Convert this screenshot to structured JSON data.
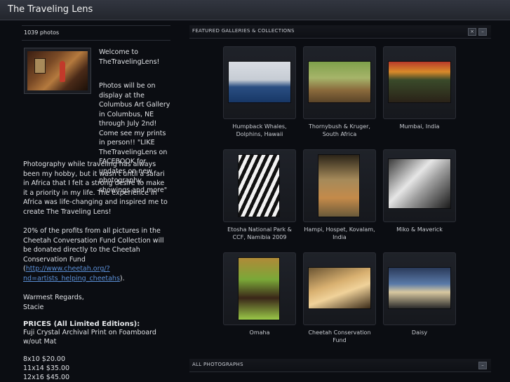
{
  "header": {
    "site_title": "The Traveling Lens"
  },
  "sidebar": {
    "photo_count": "1039 photos",
    "welcome": "Welcome to TheTravelingLens!",
    "display_note": "Photos will be on display at the Columbus Art Gallery in Columbus, NE through July 2nd! Come see my prints in person!! \"LIKE TheTravelingLens on FACEBOOK for updates on new photography, showings and more\"",
    "story": "Photography while traveling has always been my hobby, but it wasn't until a safari in Africa that I felt a strong desire to make it a priority in my life. The experience in Africa was life-changing and inspired me to create The Traveling Lens!",
    "donation_text": "20% of the profits from all pictures in the Cheetah Conversation Fund Collection will be donated directly to the Cheetah Conservation Fund (",
    "donation_link": "http://www.cheetah.org/?nd=artists_helping_cheetahs",
    "donation_end": ").",
    "regards": "Warmest Regards,",
    "signature": "Stacie",
    "prices_heading": "PRICES (All Limited Editions):",
    "print_type": "Fuji Crystal Archival Print on Foamboard w/out Mat",
    "prices": [
      "8x10 $20.00",
      "11x14 $35.00",
      "12x16 $45.00"
    ]
  },
  "main": {
    "featured_title": "FEATURED GALLERIES & COLLECTIONS",
    "all_title": "ALL PHOTOGRAPHS",
    "galleries": [
      {
        "label": "Humpback Whales, Dolphins, Hawaii"
      },
      {
        "label": "Thornybush & Kruger, South Africa"
      },
      {
        "label": "Mumbai, India"
      },
      {
        "label": "Etosha National Park & CCF, Namibia 2009"
      },
      {
        "label": "Hampi, Hospet, Kovalam, India"
      },
      {
        "label": "Miko & Maverick"
      },
      {
        "label": "Omaha"
      },
      {
        "label": "Cheetah Conservation Fund"
      },
      {
        "label": "Daisy"
      }
    ]
  }
}
